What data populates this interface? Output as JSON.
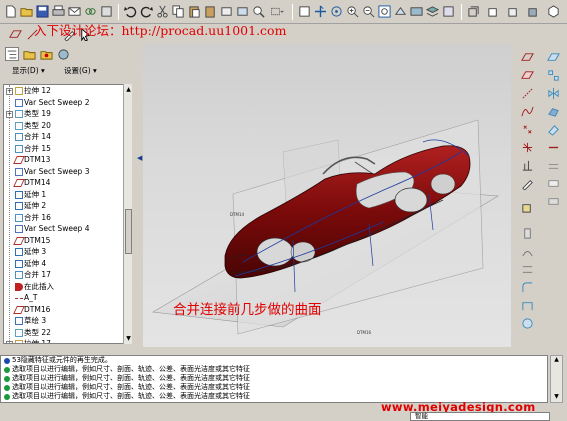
{
  "watermark": "入下设计论坛：http://procad.uu1001.com",
  "model_tree": {
    "menu_display": "显示(D) ▾",
    "menu_settings": "设置(G) ▾",
    "items": [
      {
        "label": "拉伸 12",
        "icon": "extrude-icon",
        "expand": true
      },
      {
        "label": "Var Sect Sweep 2",
        "icon": "sweep-icon",
        "expand": false
      },
      {
        "label": "类型 19",
        "icon": "surface-icon",
        "expand": true
      },
      {
        "label": "类型 20",
        "icon": "surface-icon",
        "expand": false
      },
      {
        "label": "合并 14",
        "icon": "merge-icon",
        "expand": false
      },
      {
        "label": "合并 15",
        "icon": "merge-icon",
        "expand": false
      },
      {
        "label": "DTM13",
        "icon": "datum-plane-icon",
        "expand": false
      },
      {
        "label": "Var Sect Sweep 3",
        "icon": "sweep-icon",
        "expand": false
      },
      {
        "label": "DTM14",
        "icon": "datum-plane-icon",
        "expand": false
      },
      {
        "label": "延伸 1",
        "icon": "extend-icon",
        "expand": false
      },
      {
        "label": "延伸 2",
        "icon": "extend-icon",
        "expand": false
      },
      {
        "label": "合并 16",
        "icon": "merge-icon",
        "expand": false
      },
      {
        "label": "Var Sect Sweep 4",
        "icon": "sweep-icon",
        "expand": false
      },
      {
        "label": "DTM15",
        "icon": "datum-plane-icon",
        "expand": false
      },
      {
        "label": "延伸 3",
        "icon": "extend-icon",
        "expand": false
      },
      {
        "label": "延伸 4",
        "icon": "extend-icon",
        "expand": false
      },
      {
        "label": "合并 17",
        "icon": "merge-icon",
        "expand": false
      },
      {
        "label": "在此插入",
        "icon": "insert-here-icon",
        "expand": false
      },
      {
        "label": "A_T",
        "icon": "axis-icon",
        "expand": false
      },
      {
        "label": "DTM16",
        "icon": "datum-plane-icon",
        "expand": false
      },
      {
        "label": "草绘 3",
        "icon": "sketch-icon",
        "expand": false
      },
      {
        "label": "类型 22",
        "icon": "surface-icon",
        "expand": false
      },
      {
        "label": "拉伸 17",
        "icon": "extrude-icon",
        "expand": true
      },
      {
        "label": "类型 23",
        "icon": "surface-icon",
        "expand": false
      }
    ]
  },
  "caption": "合并连接前几步做的曲面",
  "messages": [
    {
      "text": "53隐藏特征或元件的再生完成。",
      "icon": "info-icon"
    },
    {
      "text": "选取项目以进行编辑，例如尺寸、剖面、轨迹、公差、表面光洁度或其它特征",
      "icon": "arrow-icon"
    },
    {
      "text": "选取项目以进行编辑，例如尺寸、剖面、轨迹、公差、表面光洁度或其它特征",
      "icon": "arrow-icon"
    },
    {
      "text": "选取项目以进行编辑，例如尺寸、剖面、轨迹、公差、表面光洁度或其它特征",
      "icon": "arrow-icon"
    },
    {
      "text": "选取项目以进行编辑，例如尺寸、剖面、轨迹、公差、表面光洁度或其它特征",
      "icon": "arrow-icon"
    }
  ],
  "footer_url": "www.meiyadesign.com",
  "status_filter": "智能",
  "colors": {
    "car_body": "#7a0a0a",
    "accent_red": "#e00000",
    "panel": "#d4d0c8"
  }
}
